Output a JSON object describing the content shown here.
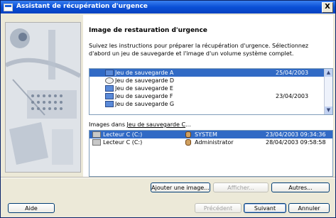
{
  "window": {
    "title": "Assistant de récupération d'urgence",
    "close_label": "X"
  },
  "main": {
    "heading": "Image de restauration d'urgence",
    "instructions": "Suivez les instructions pour préparer la récupération d'urgence. Sélectionnez d'abord un jeu de sauvegarde et l'image d'un volume système complet."
  },
  "backup_sets": [
    {
      "name": "Jeu de sauvegarde A",
      "date": "25/04/2003",
      "icon": "disk-icon",
      "selected": true
    },
    {
      "name": "Jeu de sauvegarde D",
      "date": "",
      "icon": "cd-icon",
      "selected": false
    },
    {
      "name": "Jeu de sauvegarde E",
      "date": "",
      "icon": "disk-icon",
      "selected": false
    },
    {
      "name": "Jeu de sauvegarde F",
      "date": "23/04/2003",
      "icon": "disk-icon",
      "selected": false
    },
    {
      "name": "Jeu de sauvegarde G",
      "date": "",
      "icon": "disk-icon",
      "selected": false
    }
  ],
  "images_label": {
    "prefix": "Images dans ",
    "link": "Jeu de sauvegarde C",
    "suffix": "..."
  },
  "images": [
    {
      "drive": "Lecteur C (C:)",
      "user": "SYSTEM",
      "timestamp": "23/04/2003 09:34:36",
      "selected": true
    },
    {
      "drive": "Lecteur C (C:)",
      "user": "Administrator",
      "timestamp": "28/04/2003 09:58:58",
      "selected": false
    }
  ],
  "buttons": {
    "add_image": "Ajouter une image...",
    "show": "Afficher...",
    "others": "Autres...",
    "help": "Aide",
    "previous": "Précédent",
    "next": "Suivant",
    "cancel": "Annuler"
  },
  "colors": {
    "title_bar": "#0a4fd6",
    "selection": "#316ac5",
    "dialog_bg": "#ece9d8"
  }
}
